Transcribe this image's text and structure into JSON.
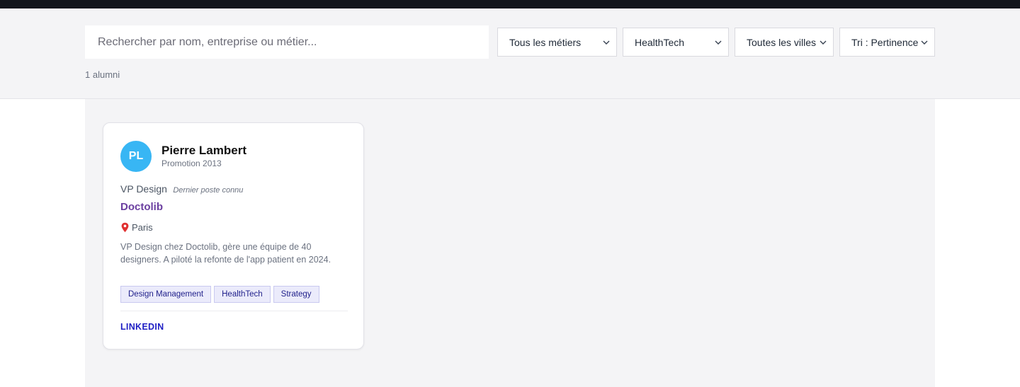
{
  "search": {
    "placeholder": "Rechercher par nom, entreprise ou métier...",
    "value": ""
  },
  "filters": {
    "metier": "Tous les métiers",
    "secteur": "HealthTech",
    "ville": "Toutes les villes",
    "tri": "Tri : Pertinence"
  },
  "results": {
    "count_label": "1 alumni"
  },
  "card": {
    "initials": "PL",
    "name": "Pierre Lambert",
    "promotion": "Promotion 2013",
    "role": "VP Design",
    "role_note": "Dernier poste connu",
    "company": "Doctolib",
    "city": "Paris",
    "bio": "VP Design chez Doctolib, gère une équipe de 40 designers. A piloté la refonte de l'app patient en 2024.",
    "tags": [
      "Design Management",
      "HealthTech",
      "Strategy"
    ],
    "linkedin_label": "LINKEDIN"
  },
  "colors": {
    "topbar": "#13161c",
    "avatar": "#38b6f4",
    "company_link": "#6b3fa0",
    "tag_bg": "#ebebfb",
    "linkedin": "#1f1fc4"
  },
  "icons": {
    "chevron": "chevron-down-icon",
    "location": "location-pin-icon"
  }
}
